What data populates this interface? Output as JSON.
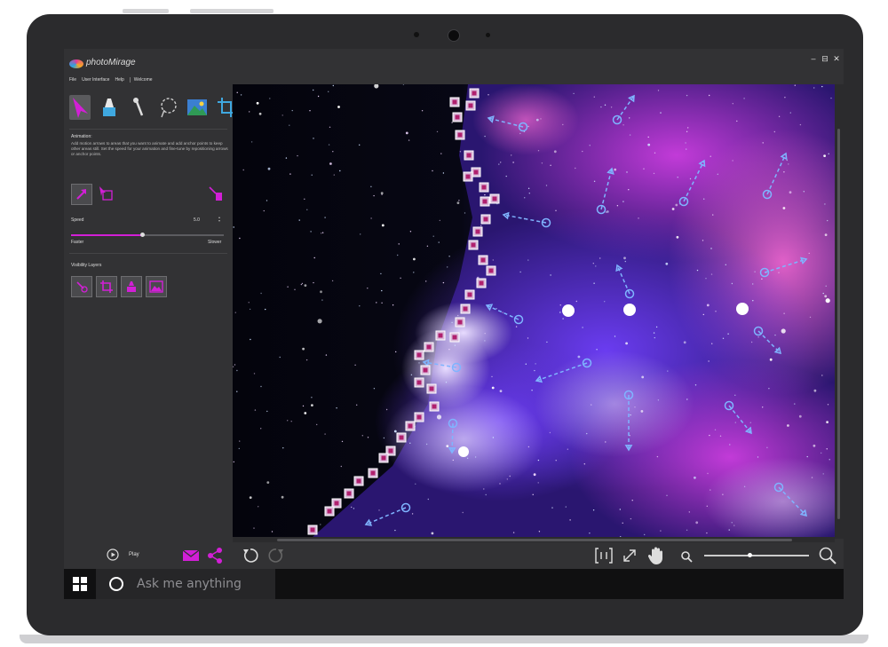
{
  "app": {
    "title": "photoMirage",
    "window_controls": [
      "–",
      "⊟",
      "✕"
    ]
  },
  "menu": [
    "File",
    "User Interface",
    "Help",
    "Welcome"
  ],
  "tools": [
    {
      "icon": "animation-arrow-icon",
      "active": true
    },
    {
      "icon": "mask-brush-icon",
      "active": false
    },
    {
      "icon": "anchor-pin-icon",
      "active": false
    },
    {
      "icon": "lasso-select-icon",
      "active": false
    },
    {
      "icon": "landscape-image-icon",
      "active": false
    },
    {
      "icon": "crop-icon",
      "active": false
    }
  ],
  "animation": {
    "heading": "Animation:",
    "description": "Add motion arrows to areas that you want to animate and add anchor points to keep other areas still. Set the speed for your animation and fine-tune by repositioning arrows or anchor points."
  },
  "speed": {
    "label": "Speed",
    "value": "5.0",
    "fraction": 0.47,
    "min_label": "Faster",
    "max_label": "Slower"
  },
  "visibility": {
    "heading": "Visibility Layers",
    "layers": [
      "animation-layer-icon",
      "crop-layer-icon",
      "mask-layer-icon",
      "image-layer-icon"
    ]
  },
  "playback": {
    "play_label": "Play"
  },
  "zoom": {
    "fraction": 0.44
  },
  "taskbar": {
    "search_placeholder": "Ask me anything"
  },
  "colors": {
    "accent": "#d21fd6",
    "panel": "#323234",
    "frame": "#2b2b2d"
  }
}
